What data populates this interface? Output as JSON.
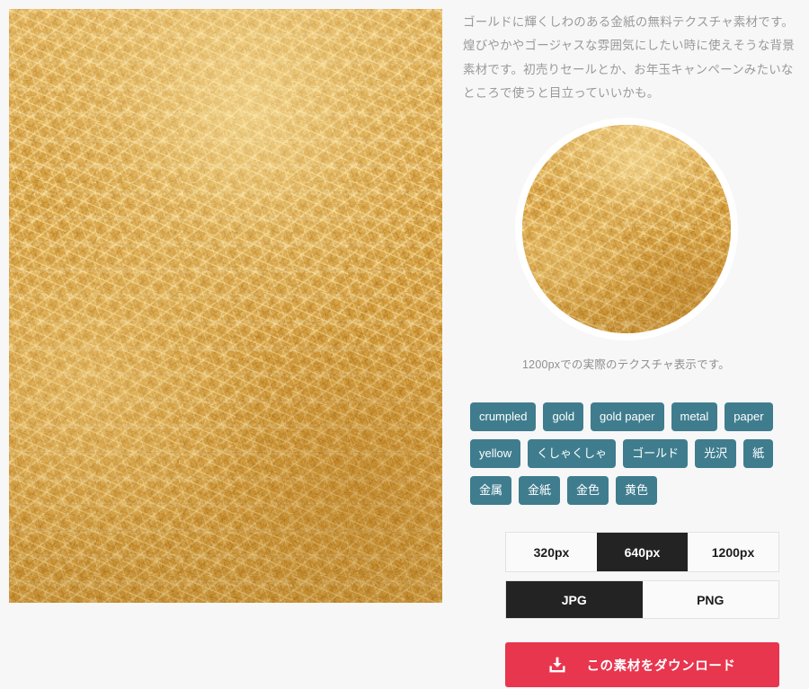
{
  "description": "ゴールドに輝くしわのある金紙の無料テクスチャ素材です。煌びやかやゴージャスな雰囲気にしたい時に使えそうな背景素材です。初売りセールとか、お年玉キャンペーンみたいなところで使うと目立っていいかも。",
  "preview": {
    "main_image_alt": "金紙 ゴールド テクスチャ 大きなプレビュー",
    "circle_image_alt": "金紙 ゴールド テクスチャ 円形プレビュー",
    "caption": "1200pxでの実際のテクスチャ表示です。"
  },
  "tags": [
    {
      "label": "crumpled"
    },
    {
      "label": "gold"
    },
    {
      "label": "gold paper"
    },
    {
      "label": "metal"
    },
    {
      "label": "paper"
    },
    {
      "label": "yellow"
    },
    {
      "label": "くしゃくしゃ"
    },
    {
      "label": "ゴールド"
    },
    {
      "label": "光沢"
    },
    {
      "label": "紙"
    },
    {
      "label": "金属"
    },
    {
      "label": "金紙"
    },
    {
      "label": "金色"
    },
    {
      "label": "黄色"
    }
  ],
  "options": {
    "sizes": [
      {
        "label": "320px",
        "selected": false
      },
      {
        "label": "640px",
        "selected": true
      },
      {
        "label": "1200px",
        "selected": false
      }
    ],
    "formats": [
      {
        "label": "JPG",
        "selected": true
      },
      {
        "label": "PNG",
        "selected": false
      }
    ]
  },
  "download": {
    "label": "この素材をダウンロード",
    "icon": "download-tray-icon"
  },
  "colors": {
    "page_background": "#f7f7f7",
    "description_text": "#9a9a9a",
    "tag_background": "#3f7d8e",
    "tag_text": "#ffffff",
    "segment_active_background": "#232323",
    "segment_inactive_background": "#fafafa",
    "segment_border": "#e2e2e2",
    "download_button": "#e8364f",
    "gold_base": "#d9a244",
    "gold_highlight": "#ffeCb2",
    "gold_shadow": "#8b570e",
    "circle_ring": "#ffffff"
  }
}
